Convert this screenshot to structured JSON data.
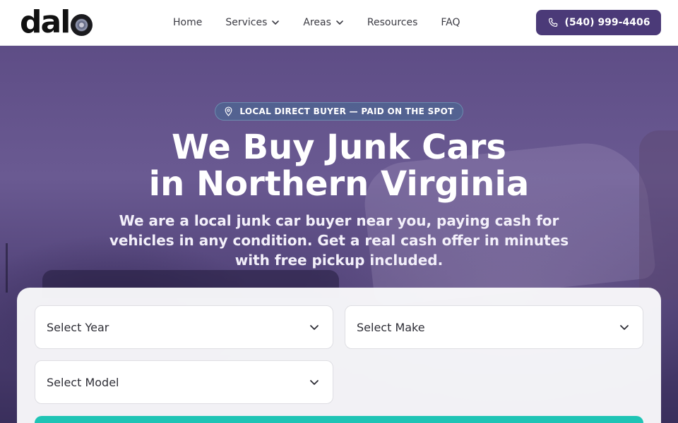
{
  "header": {
    "logo_text": "dal",
    "nav": [
      {
        "label": "Home",
        "has_dropdown": false
      },
      {
        "label": "Services",
        "has_dropdown": true
      },
      {
        "label": "Areas",
        "has_dropdown": true
      },
      {
        "label": "Resources",
        "has_dropdown": false
      },
      {
        "label": "FAQ",
        "has_dropdown": false
      }
    ],
    "phone": "(540) 999-4406"
  },
  "hero": {
    "badge": "LOCAL DIRECT BUYER — PAID ON THE SPOT",
    "title_line1": "We Buy Junk Cars",
    "title_line2": "in Northern Virginia",
    "subtitle": "We are a local junk car buyer near you, paying cash for vehicles in any condition. Get a real cash offer in minutes with free pickup included."
  },
  "form": {
    "year_placeholder": "Select Year",
    "make_placeholder": "Select Make",
    "model_placeholder": "Select Model"
  },
  "colors": {
    "brand_purple": "#4b3a78",
    "accent_teal": "#1fc4b5"
  }
}
